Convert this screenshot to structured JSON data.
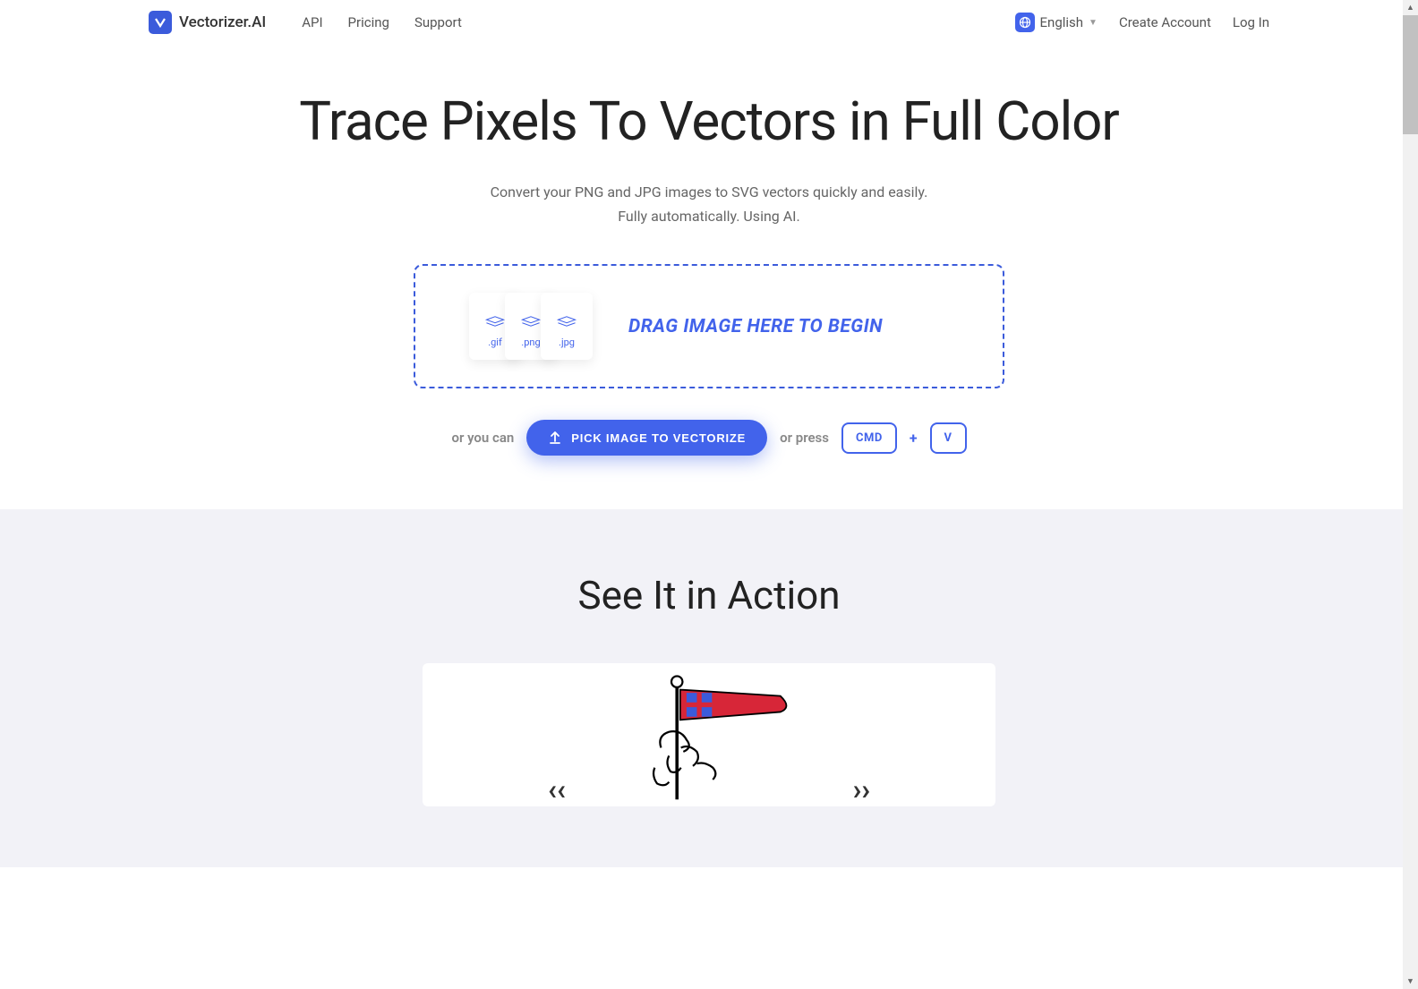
{
  "header": {
    "brand": "Vectorizer.AI",
    "nav": {
      "api": "API",
      "pricing": "Pricing",
      "support": "Support"
    },
    "lang": "English",
    "create_account": "Create Account",
    "log_in": "Log In"
  },
  "hero": {
    "title": "Trace Pixels To Vectors in Full Color",
    "subtitle_line1": "Convert your PNG and JPG images to SVG vectors quickly and easily.",
    "subtitle_line2": "Fully automatically. Using AI."
  },
  "dropzone": {
    "text": "DRAG IMAGE HERE TO BEGIN",
    "file_types": {
      "gif": ".gif",
      "png": ".png",
      "jpg": ".jpg"
    }
  },
  "actions": {
    "or_you_can": "or you can",
    "pick_button": "PICK IMAGE TO VECTORIZE",
    "or_press": "or press",
    "key_cmd": "CMD",
    "plus": "+",
    "key_v": "V"
  },
  "section2": {
    "title": "See It in Action"
  },
  "colors": {
    "primary": "#4263eb",
    "bg_grey": "#f2f2f7",
    "text_dark": "#222",
    "text_grey": "#666"
  }
}
